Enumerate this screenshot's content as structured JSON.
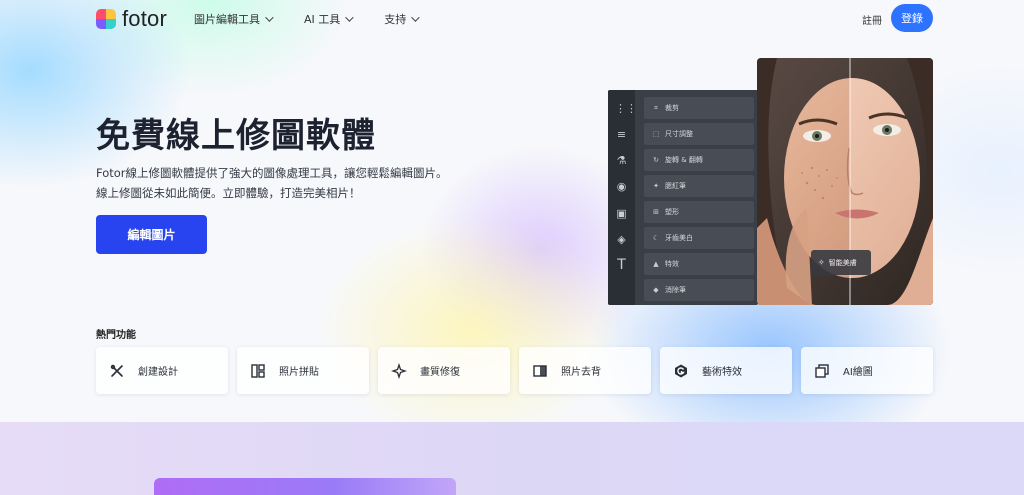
{
  "brand": {
    "name": "fotor",
    "logo_colors": [
      "#ff4d6d",
      "#ffc53d",
      "#36cfc9",
      "#7a5cff"
    ]
  },
  "nav": {
    "items": [
      {
        "label": "圖片編輯工具"
      },
      {
        "label": "AI 工具"
      },
      {
        "label": "支持"
      }
    ],
    "register_label": "註冊",
    "login_label": "登錄"
  },
  "hero": {
    "title": "免費線上修圖軟體",
    "desc_line1": "Fotor線上修圖軟體提供了強大的圖像處理工具，讓您輕鬆編輯圖片。",
    "desc_line2": "線上修圖從未如此簡便。立即體驗，打造完美相片！",
    "cta_label": "編輯圖片"
  },
  "editor": {
    "rail_icons": [
      "grid-icon",
      "sliders-icon",
      "flask-icon",
      "eye-icon",
      "frame-icon",
      "shapes-icon",
      "text-icon"
    ],
    "tools": [
      {
        "icon": "crop-icon",
        "label": "裁剪"
      },
      {
        "icon": "resize-icon",
        "label": "尺寸調整"
      },
      {
        "icon": "rotate-icon",
        "label": "旋轉 & 翻轉"
      },
      {
        "icon": "sparkle-icon",
        "label": "腮紅筆"
      },
      {
        "icon": "reshape-icon",
        "label": "塑形"
      },
      {
        "icon": "tooth-icon",
        "label": "牙齒美白"
      },
      {
        "icon": "effect-icon",
        "label": "特效"
      },
      {
        "icon": "eraser-icon",
        "label": "消除筆"
      }
    ],
    "badge_label": "智能美膚"
  },
  "popular": {
    "title": "熱門功能",
    "items": [
      {
        "icon": "design-tools-icon",
        "label": "創建設計"
      },
      {
        "icon": "collage-icon",
        "label": "照片拼貼"
      },
      {
        "icon": "enhance-icon",
        "label": "畫質修復"
      },
      {
        "icon": "bg-remover-icon",
        "label": "照片去背"
      },
      {
        "icon": "art-effect-icon",
        "label": "藝術特效"
      },
      {
        "icon": "ai-art-icon",
        "label": "AI繪圖"
      }
    ]
  },
  "colors": {
    "accent": "#2e73ff",
    "cta": "#2844f0"
  }
}
